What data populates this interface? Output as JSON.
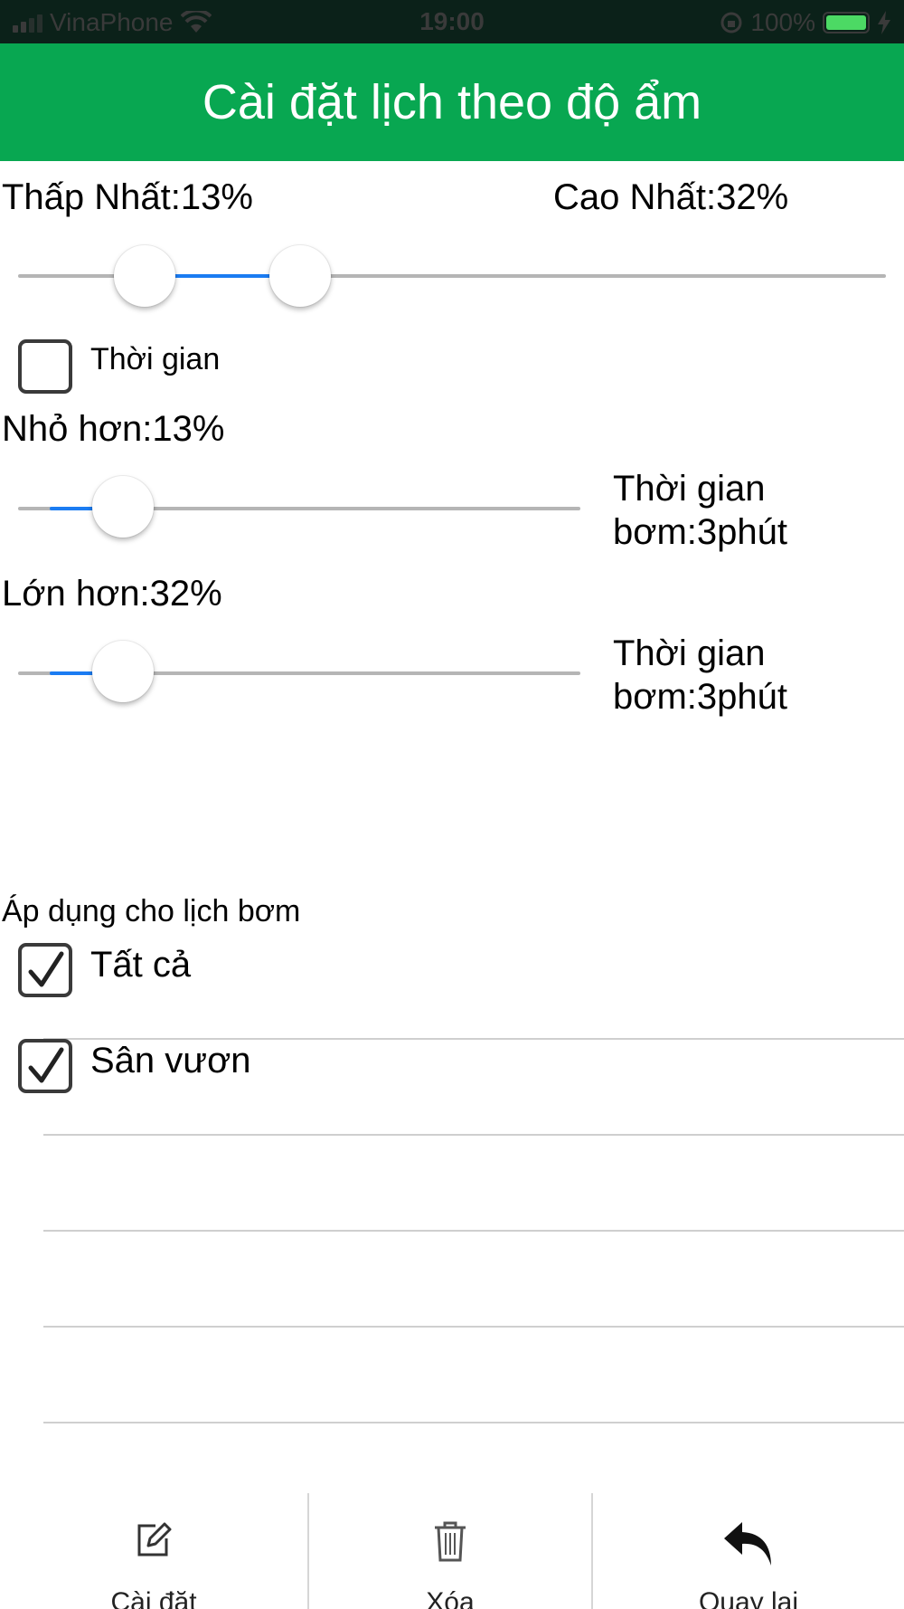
{
  "status_bar": {
    "carrier": "VinaPhone",
    "time": "19:00",
    "battery": "100%"
  },
  "header": {
    "title": "Cài đặt lịch theo độ ẩm"
  },
  "range": {
    "min_label": "Thấp Nhất:13%",
    "max_label": "Cao Nhất:32%",
    "min_value": 13,
    "max_value": 32
  },
  "time_option": {
    "label": "Thời gian",
    "checked": false
  },
  "lower": {
    "label": "Nhỏ hơn:13%",
    "pump_time_line1": "Thời gian",
    "pump_time_line2": "bơm:3phút"
  },
  "higher": {
    "label": "Lớn hơn:32%",
    "pump_time_line1": "Thời gian",
    "pump_time_line2": "bơm:3phút"
  },
  "apply": {
    "title": "Áp dụng cho lịch bơm",
    "items": [
      {
        "label": "Tất cả",
        "checked": true
      },
      {
        "label": "Sân vươn",
        "checked": true
      }
    ]
  },
  "toolbar": {
    "settings_label": "Cài  đặt",
    "delete_label": "Xóa",
    "back_label": "Quay lại"
  },
  "colors": {
    "header_bg": "#08a751",
    "slider_fill": "#1b7cf2",
    "status_bar_bg": "#0b2119"
  },
  "icons": [
    "signal-icon",
    "wifi-icon",
    "lock-rotation-icon",
    "battery-icon",
    "charging-icon",
    "checkmark-icon",
    "edit-icon",
    "trash-icon",
    "undo-icon"
  ]
}
